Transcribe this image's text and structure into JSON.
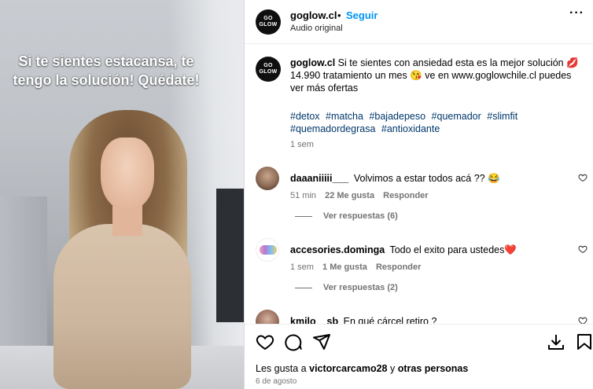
{
  "brand_logo": {
    "line1": "GO",
    "line2": "GLOW"
  },
  "video": {
    "overlay_line1": "Si te sientes estacansa, te",
    "overlay_line2": "tengo la solución! Quédate!"
  },
  "header": {
    "username": "goglow.cl",
    "separator": "•",
    "follow_label": "Seguir",
    "audio": "Audio original",
    "more_label": "···"
  },
  "caption": {
    "username": "goglow.cl",
    "text": "Si te sientes con ansiedad esta es la mejor solución 💋 14.990 tratamiento un mes 😘 ve en www.goglowchile.cl puedes ver más ofertas",
    "hashtags": [
      "#detox",
      "#matcha",
      "#bajadepeso",
      "#quemador",
      "#slimfit",
      "#quemadordegrasa",
      "#antioxidante"
    ],
    "time": "1 sem"
  },
  "comments": [
    {
      "username": "daaaniiiii___",
      "text": "Volvimos a estar todos acá ?? 😂",
      "time": "51 min",
      "likes": "22 Me gusta",
      "reply": "Responder",
      "view_replies": "Ver respuestas (6)"
    },
    {
      "username": "accesories.dominga",
      "text": "Todo el exito para ustedes❤️",
      "time": "1 sem",
      "likes": "1 Me gusta",
      "reply": "Responder",
      "view_replies": "Ver respuestas (2)"
    },
    {
      "username": "kmilo__sb",
      "text": "En qué cárcel retiro ?"
    }
  ],
  "footer": {
    "likes_prefix": "Les gusta a",
    "liker": "victorcarcamo28",
    "likes_joiner": "y",
    "others": "otras personas",
    "date": "6 de agosto"
  },
  "colors": {
    "follow": "#0095f6",
    "hashtag": "#00376b",
    "muted": "#737373"
  }
}
